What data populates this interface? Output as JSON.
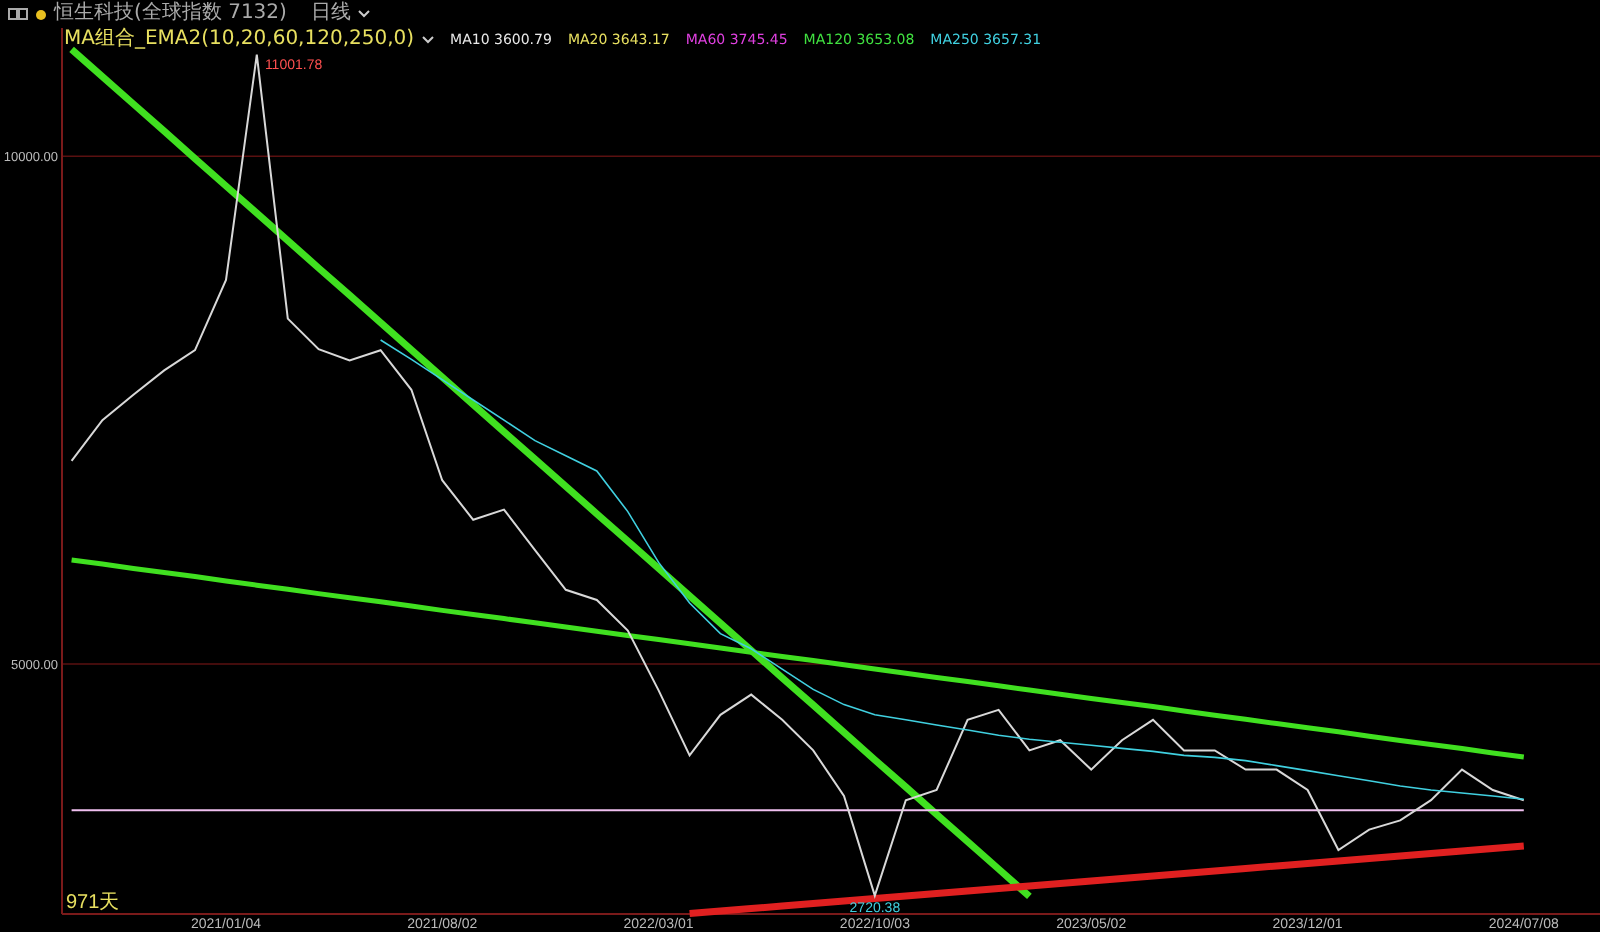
{
  "top_bar": {
    "title": "恒生科技(全球指数 7132)",
    "period": "日线"
  },
  "indicator_bar": {
    "preset": "MA组合_EMA2(10,20,60,120,250,0)",
    "items": [
      {
        "label": "MA10 3600.79",
        "color": "#e8e8e8"
      },
      {
        "label": "MA20 3643.17",
        "color": "#e8e060"
      },
      {
        "label": "MA60 3745.45",
        "color": "#e040e0"
      },
      {
        "label": "MA120 3653.08",
        "color": "#40e040"
      },
      {
        "label": "MA250 3657.31",
        "color": "#40d0e0"
      }
    ]
  },
  "chart": {
    "span_label": "971天",
    "chart_data": {
      "type": "line",
      "categories": [
        null,
        null,
        null,
        null,
        null,
        "2021/01/04",
        null,
        null,
        null,
        null,
        null,
        null,
        "2021/08/02",
        null,
        null,
        null,
        null,
        null,
        null,
        "2022/03/01",
        null,
        null,
        null,
        null,
        null,
        null,
        "2022/10/03",
        null,
        null,
        null,
        null,
        null,
        null,
        "2023/05/02",
        null,
        null,
        null,
        null,
        null,
        null,
        "2023/12/01",
        null,
        null,
        null,
        null,
        null,
        null,
        "2024/07/08"
      ],
      "series": [
        {
          "color": "#d8d8d8",
          "values": [
            7000,
            7400,
            7650,
            7890,
            8090,
            8780,
            11000,
            8400,
            8100,
            7990,
            8090,
            7700,
            6810,
            6420,
            6520,
            6120,
            5730,
            5630,
            5330,
            4740,
            4100,
            4500,
            4700,
            4450,
            4150,
            3700,
            2720,
            3660,
            3760,
            4450,
            4550,
            4150,
            4250,
            3960,
            4250,
            4450,
            4150,
            4150,
            3960,
            3960,
            3760,
            3170,
            3370,
            3460,
            3660,
            3960,
            3760,
            3660
          ]
        },
        {
          "color": "#40d0e0",
          "values": [
            null,
            null,
            null,
            null,
            null,
            null,
            null,
            null,
            null,
            null,
            8190,
            8000,
            7800,
            7600,
            7400,
            7200,
            7050,
            6900,
            6500,
            6000,
            5600,
            5300,
            5150,
            4950,
            4750,
            4600,
            4500,
            4450,
            4400,
            4350,
            4300,
            4260,
            4230,
            4200,
            4170,
            4140,
            4100,
            4080,
            4050,
            4000,
            3950,
            3900,
            3850,
            3800,
            3760,
            3730,
            3700,
            3670
          ]
        },
        {
          "color": "#40e020",
          "values": [
            11052,
            10783,
            10514,
            10245,
            9976,
            9707,
            9438,
            9169,
            8900,
            8631,
            8362,
            8093,
            7824,
            7555,
            7286,
            7017,
            6748,
            6479,
            6210,
            5941,
            5672,
            5403,
            5134,
            4865,
            4596,
            4327,
            4058,
            3789,
            3520,
            3251,
            2982,
            2713,
            null,
            null,
            null,
            null,
            null,
            null,
            null,
            null,
            null,
            null,
            null,
            null,
            null,
            null,
            null,
            null
          ]
        },
        {
          "color": "#40e020",
          "values": [
            6025,
            5984,
            5942,
            5901,
            5860,
            5818,
            5777,
            5736,
            5694,
            5653,
            5612,
            5571,
            5529,
            5488,
            5447,
            5405,
            5364,
            5323,
            5282,
            5240,
            5199,
            5158,
            5116,
            5075,
            5034,
            4992,
            4951,
            4910,
            4869,
            4827,
            4786,
            4745,
            4703,
            4662,
            4621,
            4580,
            4538,
            4497,
            4456,
            4414,
            4373,
            4332,
            4290,
            4249,
            4208,
            4167,
            4125,
            4084
          ]
        },
        {
          "color": "#f0c0f0",
          "values": [
            3560,
            3560,
            3560,
            3560,
            3560,
            3560,
            3560,
            3560,
            3560,
            3560,
            3560,
            3560,
            3560,
            3560,
            3560,
            3560,
            3560,
            3560,
            3560,
            3560,
            3560,
            3560,
            3560,
            3560,
            3560,
            3560,
            3560,
            3560,
            3560,
            3560,
            3560,
            3560,
            3560,
            3560,
            3560,
            3560,
            3560,
            3560,
            3560,
            3560,
            3560,
            3560,
            3560,
            3560,
            3560,
            3560,
            3560,
            3560
          ]
        },
        {
          "color": "#e02020",
          "values": [
            null,
            null,
            null,
            null,
            null,
            null,
            null,
            null,
            null,
            null,
            null,
            null,
            null,
            null,
            null,
            null,
            null,
            null,
            null,
            null,
            2544,
            2569,
            2593,
            2618,
            2643,
            2667,
            2692,
            2716,
            2741,
            2766,
            2790,
            2815,
            2839,
            2864,
            2889,
            2913,
            2938,
            2962,
            2987,
            3012,
            3036,
            3061,
            3085,
            3110,
            3135,
            3159,
            3184,
            3208
          ]
        }
      ],
      "ylim": [
        2539,
        11262
      ],
      "yticks": [
        {
          "value": 5000,
          "label": "5000.00"
        },
        {
          "value": 10000,
          "label": "10000.00"
        }
      ],
      "annotations": [
        "11001.78",
        "2720.38"
      ]
    }
  }
}
